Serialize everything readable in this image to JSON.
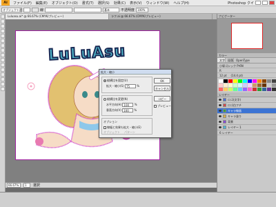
{
  "menubar": {
    "items": [
      "ファイル(F)",
      "編集(E)",
      "オブジェクト(O)",
      "書式(T)",
      "選択(S)",
      "効果(C)",
      "表示(V)",
      "ウィンドウ(W)",
      "ヘルプ(H)"
    ],
    "app_badge": "Ai",
    "right_label": "Photoshop クイ"
  },
  "control": {
    "selection": "オブジェクト選択",
    "stroke": "線",
    "style": "基本",
    "opacity": "不透明度",
    "opacity_val": "100%"
  },
  "tabs": [
    "Luluasu.ai* @ 66.67% (CMYK/プレビュー)",
    "ラフ.ai @ 66.67% (CMYK/プレビュー)"
  ],
  "title_text": "LuLuAsu",
  "status": {
    "zoom": "66.67%",
    "page": "1",
    "tool": "選択"
  },
  "dialog": {
    "title": "拡大・縮小",
    "uniform_label": "縦横比を固定(U)",
    "uniform_field": "拡大・縮小(S)",
    "uniform_val": "75",
    "pct": "%",
    "nonuniform_label": "縦横比を変更(N)",
    "h_label": "水平方向(H)",
    "h_val": "100",
    "v_label": "垂直方向(V)",
    "v_val": "100",
    "options_label": "オプション",
    "opt1": "線幅と効果も拡大・縮小(E)",
    "opt2": "オブジェクト",
    "opt3": "パターン",
    "ok": "OK",
    "cancel": "キャンセル",
    "copy": "コピー",
    "preview": "プレビュー"
  },
  "panels": {
    "color_title": "カラー",
    "color_tabs": [
      "文字",
      "段落",
      "OpenType"
    ],
    "font": "小塚ゴシック Pr6N",
    "weight": "R",
    "size": "12 pt",
    "lead": "(14.4 pt)",
    "layers_title": "レイヤー",
    "navigator": "ナビゲーター",
    "layers": [
      {
        "name": "ロゴ(文字)",
        "color": "#4b6fd6"
      },
      {
        "name": "ロゴ白フチ",
        "color": "#d64b4b"
      },
      {
        "name": "キャラ線画",
        "color": "#3ba23b",
        "sel": true
      },
      {
        "name": "キャラ塗り",
        "color": "#d6b14b"
      },
      {
        "name": "背景",
        "color": "#8a4bd6"
      },
      {
        "name": "レイヤー 1",
        "color": "#4bb5d6"
      }
    ],
    "layer_count": "6 レイヤー"
  },
  "swatches": [
    "#ffffff",
    "#000000",
    "#ff0000",
    "#ffff00",
    "#00ff00",
    "#00ffff",
    "#0000ff",
    "#ff00ff",
    "#ff8800",
    "#884400",
    "#888888",
    "#444444",
    "#ffcccc",
    "#ffeecc",
    "#ffffcc",
    "#ccffcc",
    "#ccffff",
    "#ccccff",
    "#ffccff",
    "#cc9966",
    "#996633",
    "#663300",
    "#cccccc",
    "#999999",
    "#ff6666",
    "#ffcc66",
    "#ccff66",
    "#66ff99",
    "#66ccff",
    "#9966ff",
    "#ff66cc",
    "#cc3333",
    "#339933",
    "#336699",
    "#663399",
    "#333333"
  ]
}
